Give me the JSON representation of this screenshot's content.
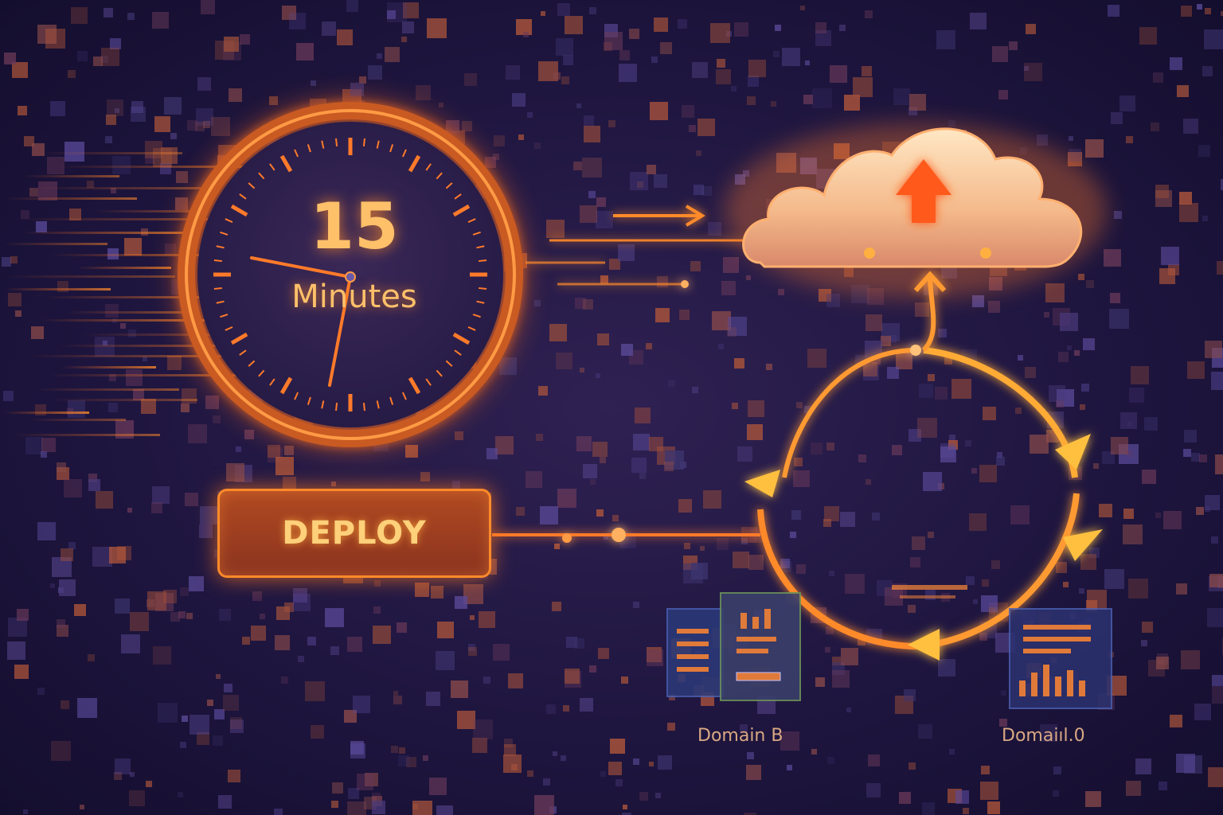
{
  "clock": {
    "number": "15",
    "unit": "Minutes"
  },
  "deploy": {
    "label": "DEPLOY"
  },
  "domains": [
    {
      "label": "Domain B"
    },
    {
      "label": "Domaiıl.0"
    }
  ],
  "colors": {
    "background": "#1f1640",
    "accent": "#ff8a2a",
    "glow": "#ffc06a",
    "cloud": "#ffd9b0"
  },
  "icons": [
    "clock-icon",
    "cloud-upload-icon",
    "cycle-arrows-icon",
    "document-icon",
    "bar-chart-icon"
  ]
}
